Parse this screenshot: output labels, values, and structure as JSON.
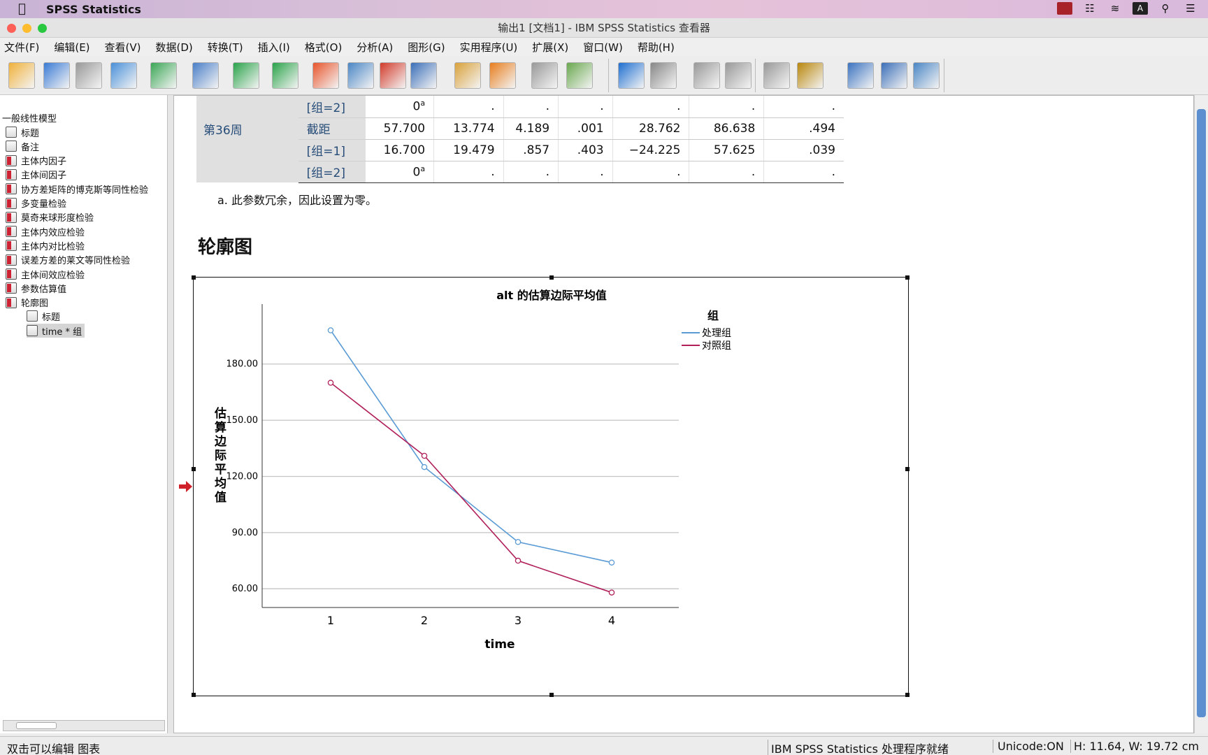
{
  "mac_menubar": {
    "app_name": "SPSS Statistics"
  },
  "window": {
    "title": "输出1 [文档1] - IBM SPSS Statistics 查看器"
  },
  "menu": [
    "文件(F)",
    "编辑(E)",
    "查看(V)",
    "数据(D)",
    "转换(T)",
    "插入(I)",
    "格式(O)",
    "分析(A)",
    "图形(G)",
    "实用程序(U)",
    "扩展(X)",
    "窗口(W)",
    "帮助(H)"
  ],
  "toolbar_icons": [
    "open-icon",
    "save-icon",
    "print-icon",
    "print-preview-icon",
    "export-icon",
    "recall-dialog-icon",
    "undo-icon",
    "redo-icon",
    "goto-case-icon",
    "goto-variable-icon",
    "insert-cases-icon",
    "variables-icon",
    "edit-output-icon",
    "run-icon",
    "designate-window-icon",
    "add-script-icon",
    "back-icon",
    "forward-icon",
    "expand-icon",
    "collapse-icon",
    "show-icon",
    "hide-icon",
    "insert-heading-icon",
    "insert-title-icon",
    "insert-text-icon"
  ],
  "navigator": {
    "root": "一般线性模型",
    "items": [
      "标题",
      "备注",
      "主体内因子",
      "主体间因子",
      "协方差矩阵的博克斯等同性检验",
      "多变量检验",
      "莫奇来球形度检验",
      "主体内效应检验",
      "主体内对比检验",
      "误差方差的莱文等同性检验",
      "主体间效应检验",
      "参数估算值",
      "轮廓图"
    ],
    "children": [
      "标题",
      "time * 组"
    ]
  },
  "table": {
    "rows": [
      {
        "week": "",
        "label": "[组=2]",
        "cells": [
          "0",
          ".",
          ".",
          ".",
          ".",
          ".",
          "."
        ],
        "sup": "a"
      },
      {
        "week": "第36周",
        "label": "截距",
        "cells": [
          "57.700",
          "13.774",
          "4.189",
          ".001",
          "28.762",
          "86.638",
          ".494"
        ],
        "sup": ""
      },
      {
        "week": "",
        "label": "[组=1]",
        "cells": [
          "16.700",
          "19.479",
          ".857",
          ".403",
          "−24.225",
          "57.625",
          ".039"
        ],
        "sup": ""
      },
      {
        "week": "",
        "label": "[组=2]",
        "cells": [
          "0",
          ".",
          ".",
          ".",
          ".",
          ".",
          "."
        ],
        "sup": "a"
      }
    ],
    "footnote": "a. 此参数冗余，因此设置为零。"
  },
  "section_title": "轮廓图",
  "chart_data": {
    "type": "line",
    "title": "alt 的估算边际平均值",
    "xlabel": "time",
    "ylabel": "估算边际平均值",
    "categories": [
      "1",
      "2",
      "3",
      "4"
    ],
    "ylim": [
      50,
      212
    ],
    "yticks": [
      "60.00",
      "90.00",
      "120.00",
      "150.00",
      "180.00"
    ],
    "yticks_values": [
      60,
      90,
      120,
      150,
      180
    ],
    "legend_title": "组",
    "legend_position": "top-right",
    "grid": true,
    "series": [
      {
        "name": "处理组",
        "color": "#5b9bd5",
        "values": [
          198,
          125,
          85,
          74
        ]
      },
      {
        "name": "对照组",
        "color": "#b0205a",
        "values": [
          170,
          131,
          75,
          58
        ]
      }
    ]
  },
  "status": {
    "left": "双击可以编辑 图表",
    "processor": "IBM SPSS Statistics 处理程序就绪",
    "unicode": "Unicode:ON",
    "size": "H: 11.64, W: 19.72 cm"
  }
}
